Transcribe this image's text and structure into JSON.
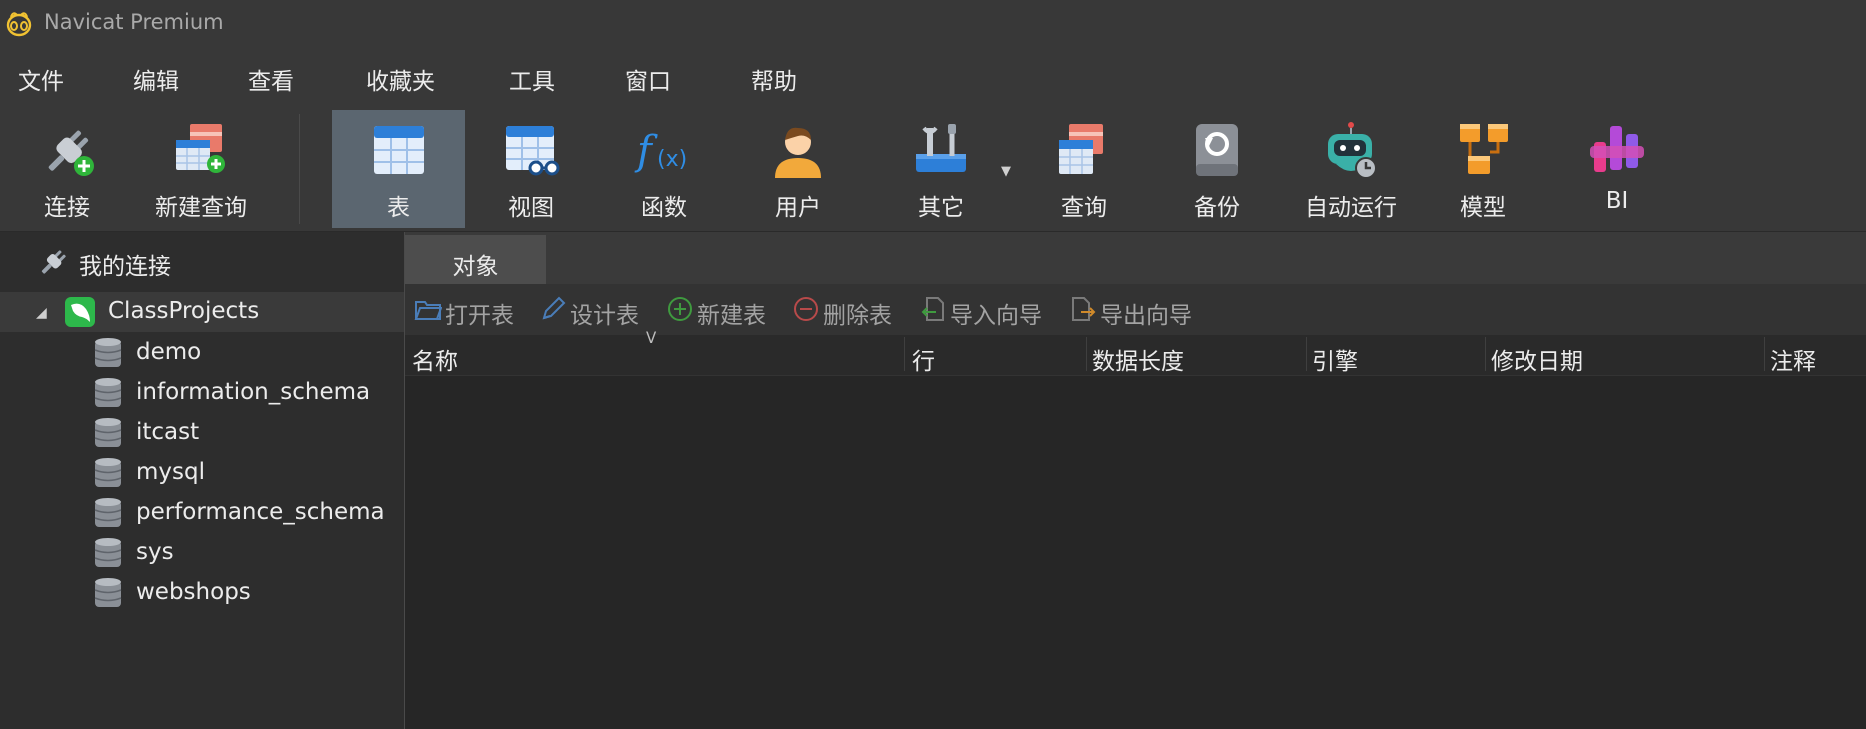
{
  "app": {
    "title": "Navicat Premium"
  },
  "menu": [
    "文件",
    "编辑",
    "查看",
    "收藏夹",
    "工具",
    "窗口",
    "帮助"
  ],
  "toolbar": {
    "connect": "连接",
    "new_query": "新建查询",
    "table": "表",
    "view": "视图",
    "function": "函数",
    "user": "用户",
    "other": "其它",
    "query": "查询",
    "backup": "备份",
    "automation": "自动运行",
    "model": "模型",
    "bi": "BI"
  },
  "sidebar": {
    "header": "我的连接",
    "connection": "ClassProjects",
    "databases": [
      "demo",
      "information_schema",
      "itcast",
      "mysql",
      "performance_schema",
      "sys",
      "webshops"
    ]
  },
  "main": {
    "tab": "对象",
    "actions": {
      "open_table": "打开表",
      "design_table": "设计表",
      "new_table": "新建表",
      "delete_table": "删除表",
      "import_wizard": "导入向导",
      "export_wizard": "导出向导"
    },
    "columns": {
      "name": "名称",
      "rows": "行",
      "data_length": "数据长度",
      "engine": "引擎",
      "modified": "修改日期",
      "comment": "注释"
    }
  },
  "colors": {
    "chrome": "#383838",
    "active_tool": "#5b6670",
    "grid_bg": "#262626",
    "mysql_green": "#2db84b"
  }
}
